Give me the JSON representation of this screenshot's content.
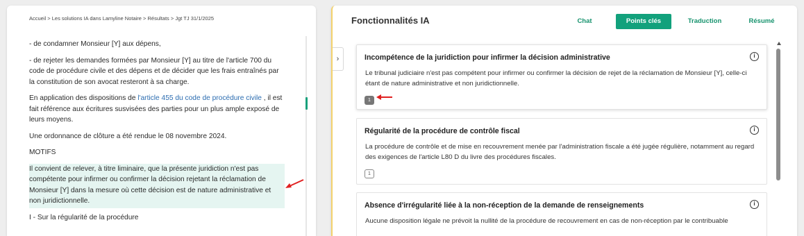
{
  "breadcrumb": "Accueil > Les solutions IA dans Lamyline Notaire > Résultats > Jgt TJ 31/1/2025",
  "document": {
    "p1": "- de condamner Monsieur [Y] aux dépens,",
    "p2": "- de rejeter les demandes formées par Monsieur [Y] au titre de l'article 700 du code de procédure civile et des dépens et de décider que les frais entraînés par la constitution de son avocat resteront à sa charge.",
    "p3_before": "En application des dispositions de ",
    "p3_link": "l'article 455 du code de procédure civile",
    "p3_after": " , il est fait référence aux écritures susvisées des parties pour un plus ample exposé de leurs moyens.",
    "p4": "Une ordonnance de clôture a été rendue le 08 novembre 2024.",
    "p5": "MOTIFS",
    "p6_highlight": "Il convient de relever, à titre liminaire, que la présente juridiction n'est pas compétente pour infirmer ou confirmer la décision rejetant la réclamation de Monsieur [Y] dans la mesure où cette décision est de nature administrative et non juridictionnelle.",
    "p7": "I - Sur la régularité de la procédure"
  },
  "panel": {
    "title": "Fonctionnalités IA",
    "tabs": [
      {
        "label": "Chat"
      },
      {
        "label": "Points clés"
      },
      {
        "label": "Traduction"
      },
      {
        "label": "Résumé"
      }
    ],
    "collapse_icon": "chevron-right-icon",
    "collapse_glyph": "›"
  },
  "cards": [
    {
      "title": "Incompétence de la juridiction pour infirmer la décision administrative",
      "body": "Le tribunal judiciaire n'est pas compétent pour infirmer ou confirmer la décision de rejet de la réclamation de Monsieur [Y], celle-ci étant de nature administrative et non juridictionnelle.",
      "badge": "1",
      "info": "i"
    },
    {
      "title": "Régularité de la procédure de contrôle fiscal",
      "body": "La procédure de contrôle et de mise en recouvrement menée par l'administration fiscale a été jugée régulière, notamment au regard des exigences de l'article L80 D du livre des procédures fiscales.",
      "badge": "1",
      "info": "i"
    },
    {
      "title": "Absence d'irrégularité liée à la non-réception de la demande de renseignements",
      "body": "Aucune disposition légale ne prévoit la nullité de la procédure de recouvrement en cas de non-réception par le contribuable",
      "info": "i"
    }
  ],
  "colors": {
    "accent": "#12a17c",
    "highlight": "#e5f5f1",
    "link": "#2b6cb0",
    "annotation_arrow": "#e02020",
    "panel_border": "#f4d26b"
  }
}
